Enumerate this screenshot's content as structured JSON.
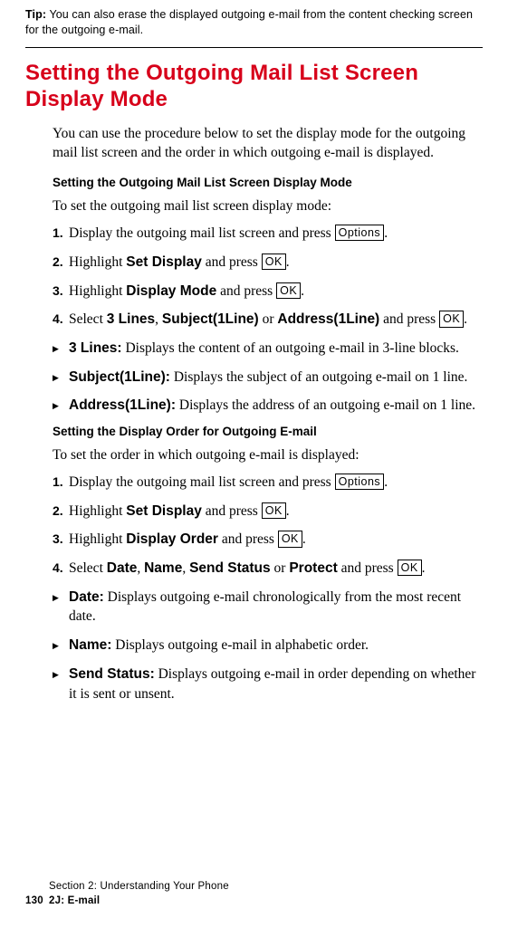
{
  "tip": {
    "label": "Tip:",
    "text": "You can also erase the displayed outgoing e-mail from the content checking screen for the outgoing e-mail."
  },
  "title": "Setting the Outgoing Mail List Screen Display Mode",
  "intro": "You can use the procedure below to set the display mode for the outgoing mail list screen and the order in which outgoing e-mail is displayed.",
  "sectionA": {
    "heading": "Setting the Outgoing Mail List Screen Display Mode",
    "lead": "To set the outgoing mail list screen display mode:",
    "steps": {
      "s1a": "Display the outgoing mail list screen and press ",
      "s1key": "Options",
      "s1b": ".",
      "s2a": "Highlight ",
      "s2bold": "Set Display",
      "s2b": " and press ",
      "s2key": "OK",
      "s2c": ".",
      "s3a": "Highlight ",
      "s3bold": "Display Mode",
      "s3b": " and press ",
      "s3key": "OK",
      "s3c": ".",
      "s4a": "Select ",
      "s4bold1": "3 Lines",
      "s4sep1": ", ",
      "s4bold2": "Subject(1Line)",
      "s4sep2": " or ",
      "s4bold3": "Address(1Line)",
      "s4b": " and press ",
      "s4key": "OK",
      "s4c": "."
    },
    "bullets": {
      "b1label": "3 Lines:",
      "b1text": " Displays the content of an outgoing e-mail in 3-line blocks.",
      "b2label": "Subject(1Line):",
      "b2text": " Displays the subject of an outgoing e-mail on 1 line.",
      "b3label": "Address(1Line):",
      "b3text": " Displays the address of an outgoing e-mail on 1 line."
    }
  },
  "sectionB": {
    "heading": "Setting the Display Order for Outgoing E-mail",
    "lead": "To set the order in which outgoing e-mail is displayed:",
    "steps": {
      "s1a": "Display the outgoing mail list screen and press ",
      "s1key": "Options",
      "s1b": ".",
      "s2a": "Highlight ",
      "s2bold": "Set Display",
      "s2b": " and press ",
      "s2key": "OK",
      "s2c": ".",
      "s3a": "Highlight ",
      "s3bold": "Display Order",
      "s3b": " and press ",
      "s3key": "OK",
      "s3c": ".",
      "s4a": "Select ",
      "s4bold1": "Date",
      "s4sep1": ", ",
      "s4bold2": "Name",
      "s4sep2": ", ",
      "s4bold3": "Send Status",
      "s4sep3": " or ",
      "s4bold4": "Protect",
      "s4b": " and press ",
      "s4key": "OK",
      "s4c": "."
    },
    "bullets": {
      "b1label": "Date:",
      "b1text": " Displays outgoing e-mail chronologically from the most recent date.",
      "b2label": "Name:",
      "b2text": " Displays outgoing e-mail in alphabetic order.",
      "b3label": "Send Status:",
      "b3text": " Displays outgoing e-mail in order depending on whether it is sent or unsent."
    }
  },
  "footer": {
    "section": "Section 2: Understanding Your Phone",
    "page": "130",
    "chapter": "2J: E-mail"
  }
}
